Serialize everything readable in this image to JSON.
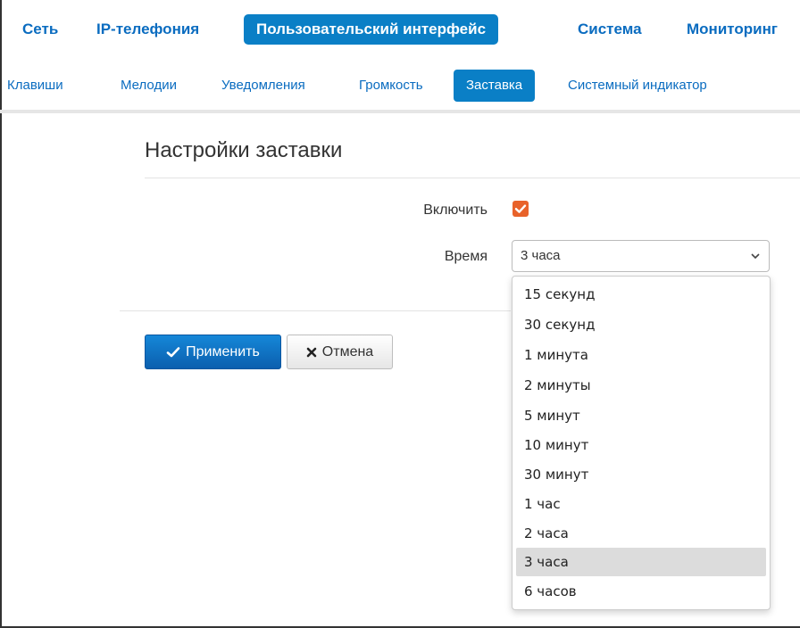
{
  "top_nav": [
    "Сеть",
    "IP-телефония",
    "Пользовательский интерфейс",
    "Система",
    "Мониторинг"
  ],
  "sub_nav": [
    "Клавиши",
    "Мелодии",
    "Уведомления",
    "Громкость",
    "Заставка",
    "Системный индикатор"
  ],
  "page_title": "Настройки заставки",
  "form": {
    "enable_label": "Включить",
    "enable_checked": true,
    "time_label": "Время",
    "time_value": "3 часа"
  },
  "dropdown": {
    "options": [
      "15 секунд",
      "30 секунд",
      "1 минута",
      "2 минуты",
      "5 минут",
      "10 минут",
      "30 минут",
      "1 час",
      "2 часа",
      "3 часа",
      "6 часов"
    ],
    "selected": "3 часа"
  },
  "buttons": {
    "apply": "Применить",
    "cancel": "Отмена"
  },
  "colors": {
    "accent": "#0a7fc6",
    "link": "#0a6cc0",
    "checkbox": "#e8622a"
  }
}
